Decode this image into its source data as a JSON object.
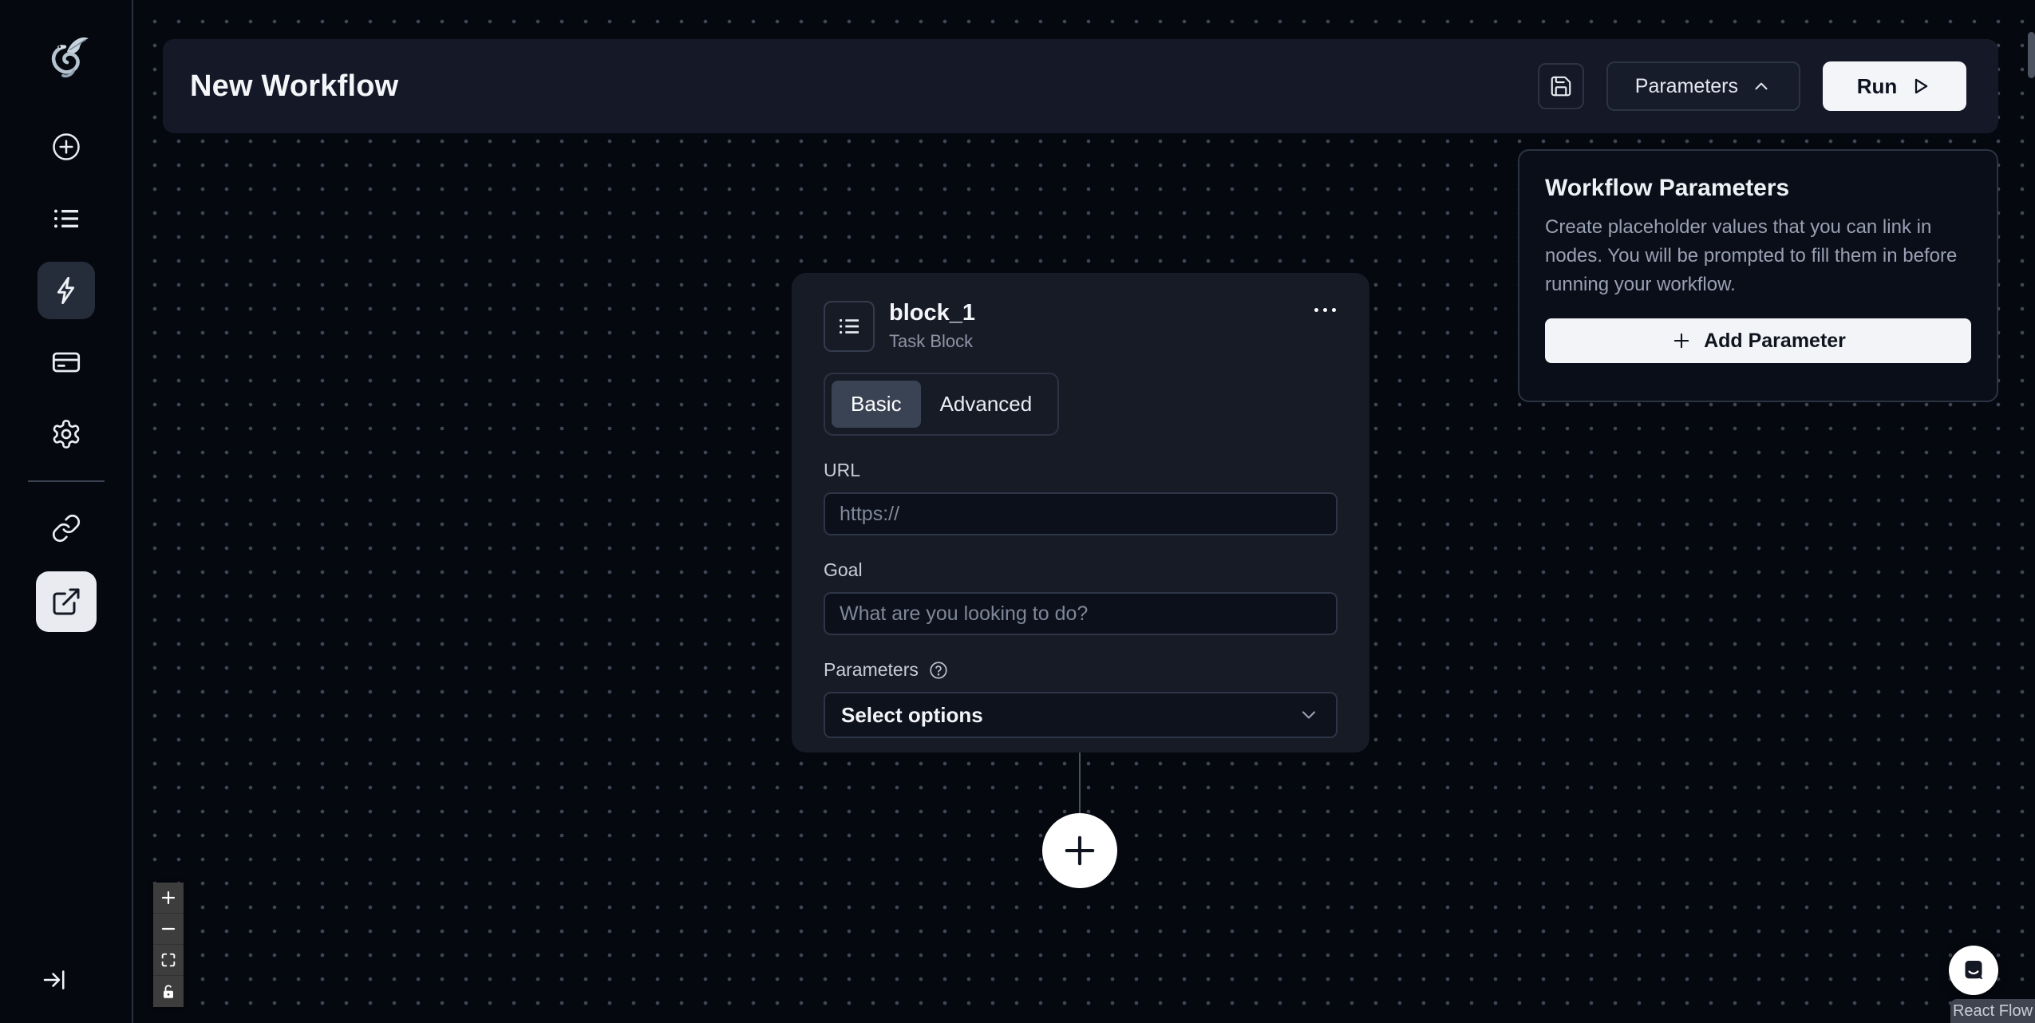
{
  "colors": {
    "canvas_bg": "#05080f",
    "surface": "#171b26",
    "header_bg": "#141827",
    "panel_border": "#2b3342",
    "active_tab_bg": "#3a4354",
    "accent_light": "#f2f4f7",
    "muted_text": "#98a0b3",
    "dot_grid": "#3f4656"
  },
  "sidebar": {
    "logo": "skyvern-dragon-logo",
    "items": [
      {
        "id": "create",
        "icon": "plus-circle-icon",
        "active": false
      },
      {
        "id": "tasks",
        "icon": "list-icon",
        "active": false
      },
      {
        "id": "workflows",
        "icon": "lightning-icon",
        "active": true
      },
      {
        "id": "billing",
        "icon": "credit-card-icon",
        "active": false
      },
      {
        "id": "settings",
        "icon": "gear-icon",
        "active": false
      },
      {
        "id": "link",
        "icon": "link-icon",
        "active": false
      },
      {
        "id": "external",
        "icon": "external-link-icon",
        "active": true
      }
    ],
    "collapse_icon": "arrow-to-bar-icon"
  },
  "header": {
    "title": "New Workflow",
    "save_icon": "floppy-save-icon",
    "parameters_button": "Parameters",
    "parameters_chevron": "chevron-up-icon",
    "run_button": "Run",
    "run_icon": "play-icon"
  },
  "params_panel": {
    "title": "Workflow Parameters",
    "description": "Create placeholder values that you can link in nodes. You will be prompted to fill them in before running your workflow.",
    "add_button": "Add Parameter"
  },
  "node": {
    "title": "block_1",
    "subtitle": "Task Block",
    "menu_icon": "ellipsis-icon",
    "tabs": [
      {
        "label": "Basic",
        "active": true
      },
      {
        "label": "Advanced",
        "active": false
      }
    ],
    "url": {
      "label": "URL",
      "placeholder": "https://",
      "value": ""
    },
    "goal": {
      "label": "Goal",
      "placeholder": "What are you looking to do?",
      "value": ""
    },
    "parameters": {
      "label": "Parameters",
      "help_icon": "help-circle-icon",
      "placeholder": "Select options"
    }
  },
  "canvas": {
    "add_node_icon": "plus-icon",
    "controls": [
      {
        "id": "zoom-in",
        "icon": "plus-icon"
      },
      {
        "id": "zoom-out",
        "icon": "minus-icon"
      },
      {
        "id": "fit-view",
        "icon": "fit-view-icon"
      },
      {
        "id": "toggle-interactivity",
        "icon": "unlock-icon"
      }
    ],
    "attribution": "React Flow",
    "chat_icon": "chat-bubble-icon"
  }
}
